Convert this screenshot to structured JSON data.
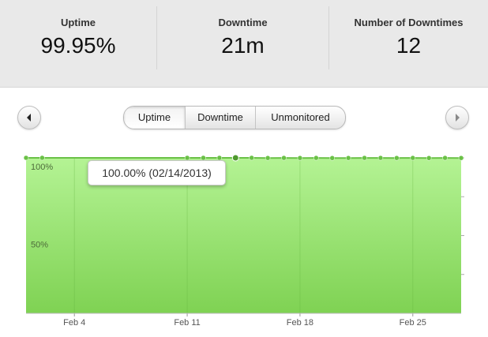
{
  "stats": {
    "uptime": {
      "label": "Uptime",
      "value": "99.95%"
    },
    "downtime": {
      "label": "Downtime",
      "value": "21m"
    },
    "count": {
      "label": "Number of Downtimes",
      "value": "12"
    }
  },
  "nav": {
    "prev_icon": "chevron-left-icon",
    "next_icon": "chevron-right-icon"
  },
  "tabs": [
    {
      "label": "Uptime",
      "active": true
    },
    {
      "label": "Downtime",
      "active": false
    },
    {
      "label": "Unmonitored",
      "active": false
    }
  ],
  "tooltip": {
    "text": "100.00% (02/14/2013)"
  },
  "colors": {
    "area_top": "#b4f394",
    "area_bottom": "#7fd253",
    "line": "#6ac146",
    "point": "#6ac146",
    "grid": "#5fae3c"
  },
  "chart_data": {
    "type": "area",
    "xlabel": "",
    "ylabel": "",
    "ylim": [
      0,
      100
    ],
    "yticks": [
      {
        "value": 100,
        "label": "100%"
      },
      {
        "value": 50,
        "label": "50%"
      }
    ],
    "xticks": [
      {
        "day": 4,
        "label": "Feb 4"
      },
      {
        "day": 11,
        "label": "Feb 11"
      },
      {
        "day": 18,
        "label": "Feb 18"
      },
      {
        "day": 25,
        "label": "Feb 25"
      }
    ],
    "xlim": [
      1,
      28
    ],
    "highlight_day": 14,
    "series": [
      {
        "days": [
          1,
          2,
          3,
          4,
          5,
          6,
          7,
          8,
          9,
          10,
          11,
          12,
          13,
          14,
          15,
          16,
          17,
          18,
          19,
          20,
          21,
          22,
          23,
          24,
          25,
          26,
          27,
          28
        ],
        "values": [
          100,
          100,
          100,
          100,
          100,
          100,
          100,
          100,
          100,
          100,
          100,
          100,
          100,
          100,
          100,
          99.9,
          99.95,
          99.9,
          99.95,
          99.85,
          99.9,
          99.95,
          99.95,
          99.9,
          99.95,
          99.85,
          99.95,
          99.9
        ],
        "show_marker": [
          true,
          true,
          false,
          false,
          false,
          false,
          false,
          false,
          false,
          false,
          true,
          true,
          true,
          true,
          true,
          true,
          true,
          true,
          true,
          true,
          true,
          true,
          true,
          true,
          true,
          true,
          true,
          true
        ]
      }
    ]
  }
}
